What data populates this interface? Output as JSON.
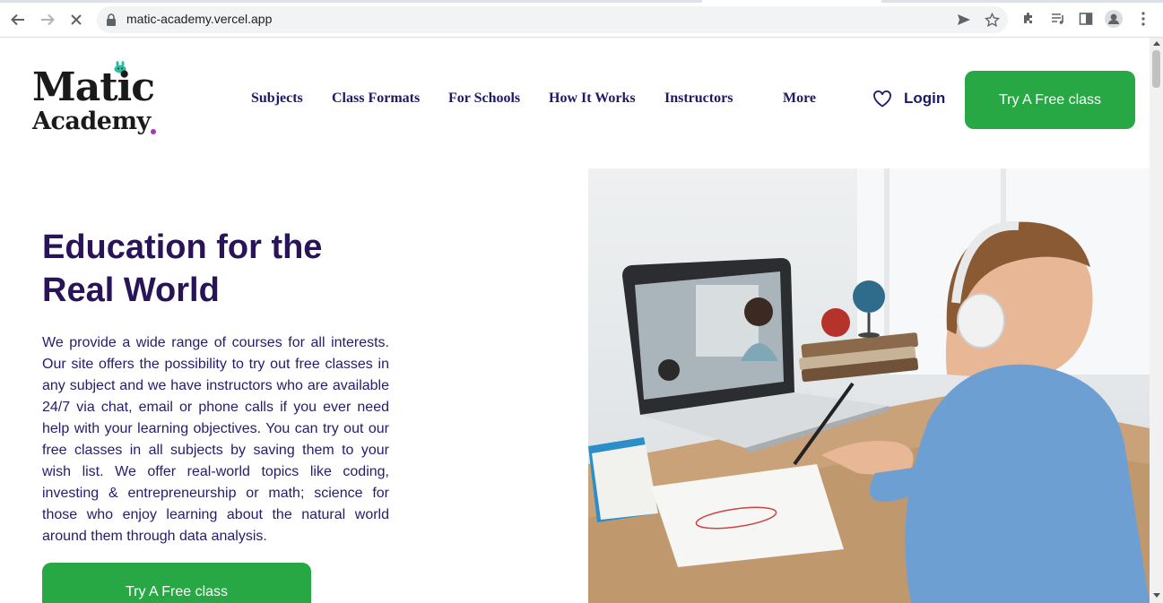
{
  "browser": {
    "url": "matic-academy.vercel.app"
  },
  "header": {
    "logo": {
      "line1": "Matic",
      "line2": "Academy"
    },
    "nav": [
      {
        "label": "Subjects"
      },
      {
        "label": "Class Formats"
      },
      {
        "label": "For Schools"
      },
      {
        "label": "How It Works"
      },
      {
        "label": "Instructors"
      },
      {
        "label": "More"
      }
    ],
    "login_label": "Login",
    "cta_label": "Try A Free class"
  },
  "hero": {
    "title_line1": "Education for the",
    "title_line2": "Real World",
    "description": "We provide a wide range of courses for all interests. Our site offers the possibility to try out free classes in any subject and we have instructors who are available 24/7 via chat, email or phone calls if you ever need help with your learning objectives. You can try out our free classes in all subjects by saving them to your wish list. We offer real-world topics like coding, investing & entrepreneurship or math; science for those who enjoy learning about the natural world around them through data analysis.",
    "cta_label": "Try A Free class"
  },
  "colors": {
    "brand_green": "#28a745",
    "nav_text": "#1c1a6b",
    "title_text": "#2a1458",
    "logo_accent": "#a23bb3",
    "bunny": "#2bbf9f"
  }
}
